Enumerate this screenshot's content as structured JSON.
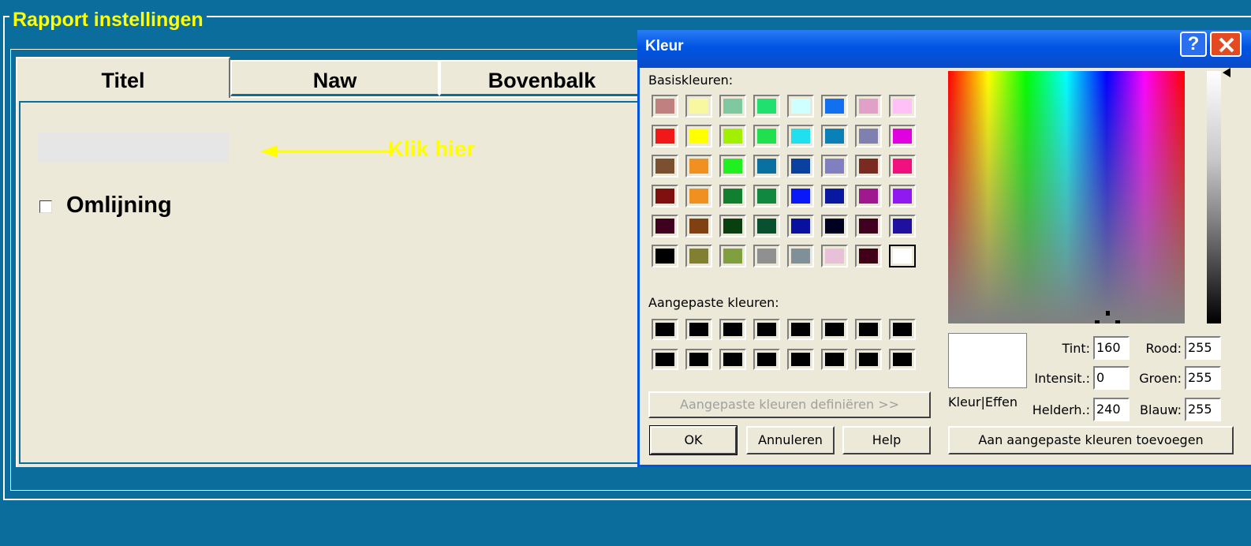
{
  "group_title": "Rapport instellingen",
  "tabs": [
    {
      "label": "Titel"
    },
    {
      "label": "Naw"
    },
    {
      "label": "Bovenbalk"
    }
  ],
  "annotation": {
    "text": "Klik hier",
    "color": "#ffff00"
  },
  "outline_checkbox": {
    "label": "Omlijning",
    "checked": false
  },
  "selected_color_swatch": "#e6e6e6",
  "dialog": {
    "title": "Kleur",
    "help_icon": "?",
    "basic_label": "Basiskleuren:",
    "basic_colors": [
      [
        "#c08080",
        "#f8f8a0",
        "#80c8a0",
        "#20e070",
        "#d0ffff",
        "#1070f0",
        "#e0a0c8",
        "#ffc0f8"
      ],
      [
        "#f01818",
        "#ffff00",
        "#a0f000",
        "#20e050",
        "#20e0f0",
        "#0a80b8",
        "#8080b0",
        "#e000e0"
      ],
      [
        "#7a5030",
        "#f09020",
        "#20f020",
        "#0a70a0",
        "#0a40a0",
        "#8080c0",
        "#7a2a20",
        "#f01080"
      ],
      [
        "#801010",
        "#f09020",
        "#108030",
        "#108840",
        "#0818f8",
        "#0818a0",
        "#a01890",
        "#9018f0"
      ],
      [
        "#400020",
        "#804010",
        "#084010",
        "#085030",
        "#0810a0",
        "#000020",
        "#400020",
        "#2010a0"
      ],
      [
        "#000000",
        "#808030",
        "#80a040",
        "#909090",
        "#809098",
        "#e8c0d8",
        "#400018",
        "#ffffff"
      ]
    ],
    "custom_label": "Aangepaste kleuren:",
    "custom_colors": [
      "#000000",
      "#000000",
      "#000000",
      "#000000",
      "#000000",
      "#000000",
      "#000000",
      "#000000",
      "#000000",
      "#000000",
      "#000000",
      "#000000",
      "#000000",
      "#000000",
      "#000000",
      "#000000"
    ],
    "define_button": "Aangepaste kleuren definiëren >>",
    "ok_button": "OK",
    "cancel_button": "Annuleren",
    "help_button": "Help",
    "add_button": "Aan aangepaste kleuren toevoegen",
    "preview_label": "Kleur|Effen",
    "fields": {
      "tint": {
        "label": "Tint:",
        "value": "160"
      },
      "intensity": {
        "label": "Intensit.:",
        "value": "0"
      },
      "brightness": {
        "label": "Helderh.:",
        "value": "240"
      },
      "red": {
        "label": "Rood:",
        "value": "255"
      },
      "green": {
        "label": "Groen:",
        "value": "255"
      },
      "blue": {
        "label": "Blauw:",
        "value": "255"
      }
    },
    "current_color": "#ffffff"
  }
}
